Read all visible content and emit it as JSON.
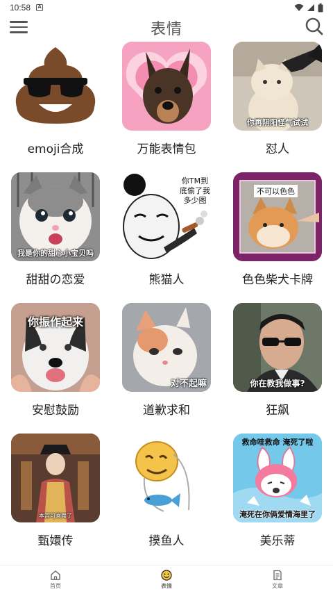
{
  "status_bar": {
    "time": "10:58",
    "notification_badge": "A"
  },
  "app_bar": {
    "title": "表情"
  },
  "grid": {
    "items": [
      {
        "label": "emoji合成",
        "caption": ""
      },
      {
        "label": "万能表情包",
        "caption": ""
      },
      {
        "label": "怼人",
        "caption": "你再阴阳怪气试试"
      },
      {
        "label": "甜甜の恋爱",
        "caption": "我是你的甜心小宝贝吗"
      },
      {
        "label": "熊猫人",
        "caption": "你TM到底偷了我多少图"
      },
      {
        "label": "色色柴犬卡牌",
        "caption": "不可以色色"
      },
      {
        "label": "安慰鼓励",
        "caption": "你振作起来"
      },
      {
        "label": "道歉求和",
        "caption": "对不起嘛"
      },
      {
        "label": "狂飙",
        "caption": "你在教我做事?"
      },
      {
        "label": "甄嬛传",
        "caption": "本宫可乘舞了"
      },
      {
        "label": "摸鱼人",
        "caption": ""
      },
      {
        "label": "美乐蒂",
        "caption_top": "救命哇救命 淹死了啦",
        "caption": "淹死在你俩爱情海里了"
      }
    ]
  },
  "bottom_nav": {
    "items": [
      {
        "label": "首页",
        "icon": "home-icon",
        "active": false
      },
      {
        "label": "表情",
        "icon": "smile-icon",
        "active": true
      },
      {
        "label": "文章",
        "icon": "document-icon",
        "active": false
      }
    ]
  }
}
